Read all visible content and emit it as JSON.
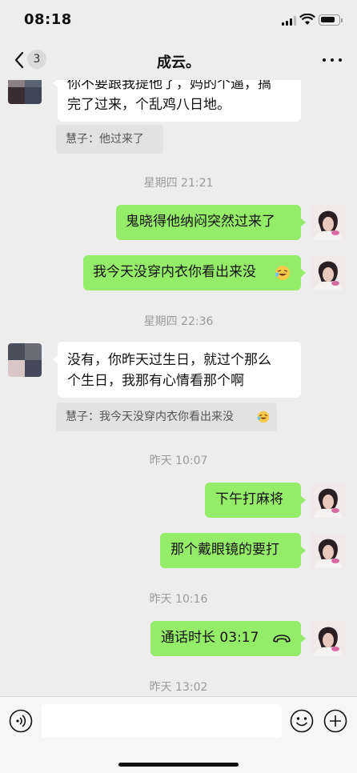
{
  "status": {
    "time": "08:18",
    "battery_level": 0.85
  },
  "nav": {
    "unread_count": "3",
    "title": "成云。"
  },
  "messages": {
    "m1": {
      "line1": "你不要跟我提他了，妈的个逼，搞",
      "line2": "完了过来，个乱鸡八日地。"
    },
    "q1": {
      "text": "慧子：他过来了"
    },
    "ts1": "星期四 21:21",
    "m2": {
      "text": "鬼晓得他纳闷突然过来了"
    },
    "m3": {
      "text": "我今天没穿内衣你看出来没"
    },
    "ts2": "星期四 22:36",
    "m4": {
      "line1": "没有，你昨天过生日，就过个那么",
      "line2": "个生日，我那有心情看那个啊"
    },
    "q2": {
      "text": "慧子：我今天没穿内衣你看出来没"
    },
    "ts3": "昨天 10:07",
    "m5": {
      "text": "下午打麻将"
    },
    "m6": {
      "text": "那个戴眼镜的要打"
    },
    "ts4": "昨天 10:16",
    "m7": {
      "text": "通话时长 03:17"
    },
    "ts5": "昨天 13:02"
  },
  "input": {
    "value": "",
    "placeholder": ""
  },
  "icons": {
    "back": "chevron-left-icon",
    "more": "more-dots-icon",
    "voice": "voice-icon",
    "emoji": "emoji-icon",
    "plus": "plus-icon",
    "phone": "phone-icon",
    "laugh": "laugh-cry-emoji-icon"
  },
  "colors": {
    "bg": "#ededed",
    "out_bubble": "#95ec69",
    "in_bubble": "#ffffff",
    "timestamp": "#9a9a9a"
  }
}
